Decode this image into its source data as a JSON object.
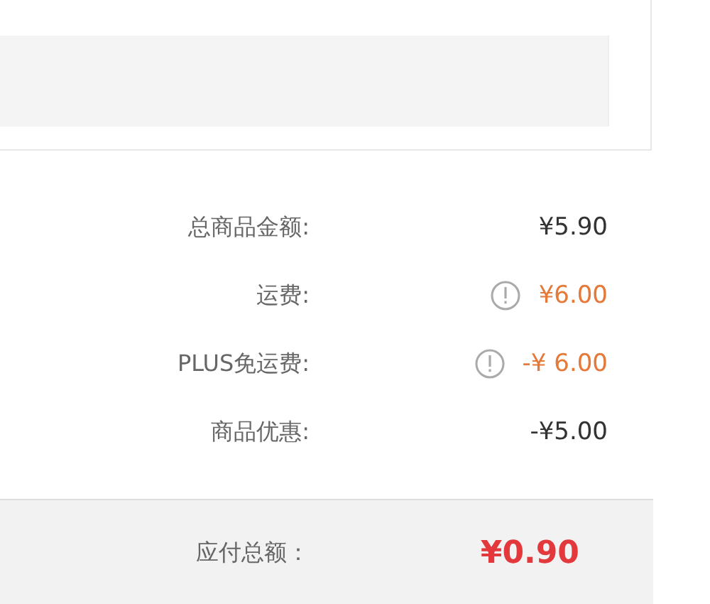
{
  "summary_rows": [
    {
      "label": "总商品金额:",
      "value": "¥5.90",
      "info_icon": false,
      "highlight": false
    },
    {
      "label": "运费:",
      "value": "¥6.00",
      "info_icon": true,
      "highlight": true
    },
    {
      "label": "PLUS免运费:",
      "value": "-¥ 6.00",
      "info_icon": true,
      "highlight": true
    },
    {
      "label": "商品优惠:",
      "value": "-¥5.00",
      "info_icon": false,
      "highlight": false
    }
  ],
  "total": {
    "label": "应付总额：",
    "value": "¥0.90"
  }
}
